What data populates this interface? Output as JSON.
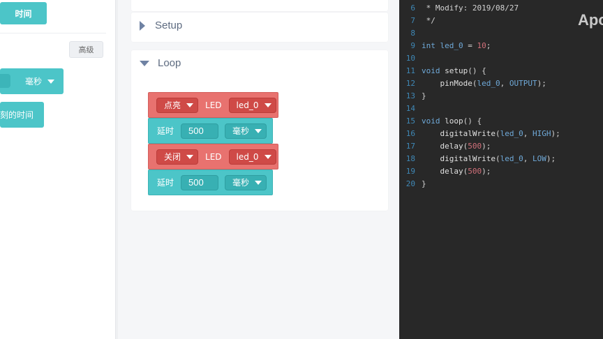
{
  "palette": {
    "time_button": "时间",
    "advanced_button": "高级",
    "delay_unit": "毫秒",
    "millis_label": "刻的时间"
  },
  "workspace": {
    "setup_title": "Setup",
    "loop_title": "Loop",
    "blocks": [
      {
        "action": "点亮",
        "label": "LED",
        "pin": "led_0"
      },
      {
        "label": "延时",
        "value": "500",
        "unit": "毫秒"
      },
      {
        "action": "关闭",
        "label": "LED",
        "pin": "led_0"
      },
      {
        "label": "延时",
        "value": "500",
        "unit": "毫秒"
      }
    ]
  },
  "editor": {
    "watermark": "Apc",
    "lines": [
      {
        "no": "6",
        "text": " * Modify: 2019/08/27"
      },
      {
        "no": "7",
        "text": " */"
      },
      {
        "no": "8",
        "text": ""
      },
      {
        "no": "9",
        "kw": "int",
        "var": "led_0",
        "eq": " = ",
        "num": "10",
        "end": ";"
      },
      {
        "no": "10",
        "text": ""
      },
      {
        "no": "11",
        "kw": "void",
        "fn": "setup",
        "end": "() {"
      },
      {
        "no": "12",
        "fn": "pinMode",
        "a1": "led_0",
        "a2": "OUTPUT",
        "end": ");"
      },
      {
        "no": "13",
        "text": "}"
      },
      {
        "no": "14",
        "text": ""
      },
      {
        "no": "15",
        "kw": "void",
        "fn": "loop",
        "end": "() {"
      },
      {
        "no": "16",
        "fn": "digitalWrite",
        "a1": "led_0",
        "a2": "HIGH",
        "end": ");"
      },
      {
        "no": "17",
        "fn": "delay",
        "num": "500",
        "end": ");"
      },
      {
        "no": "18",
        "fn": "digitalWrite",
        "a1": "led_0",
        "a2": "LOW",
        "end": ");"
      },
      {
        "no": "19",
        "fn": "delay",
        "num": "500",
        "end": ");"
      },
      {
        "no": "20",
        "text": "}"
      }
    ]
  }
}
